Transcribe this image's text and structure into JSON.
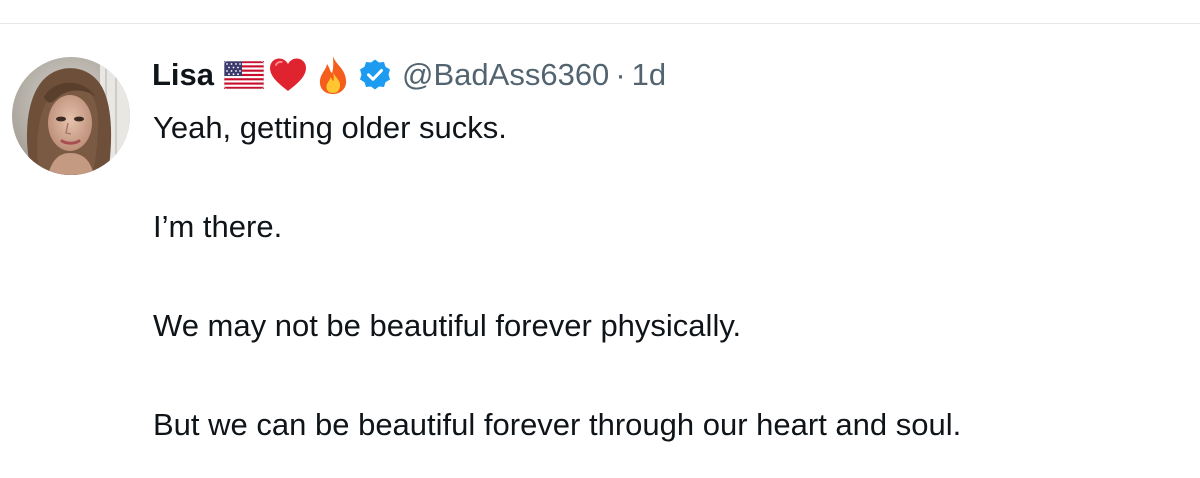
{
  "tweet": {
    "author": {
      "display_name": "Lisa",
      "emojis": [
        "flag-usa-icon",
        "red-heart-icon",
        "fire-icon"
      ],
      "verified": true,
      "handle": "@BadAss6360"
    },
    "separator": "·",
    "timestamp": "1d",
    "paragraphs": [
      "Yeah, getting older sucks.",
      "I’m there.",
      "We may not be beautiful forever physically.",
      "But we can be beautiful forever through our heart and soul."
    ]
  },
  "colors": {
    "text_primary": "#0f1419",
    "text_secondary": "#536471",
    "verified_blue": "#1d9bf0",
    "divider": "#e6e9ec"
  }
}
